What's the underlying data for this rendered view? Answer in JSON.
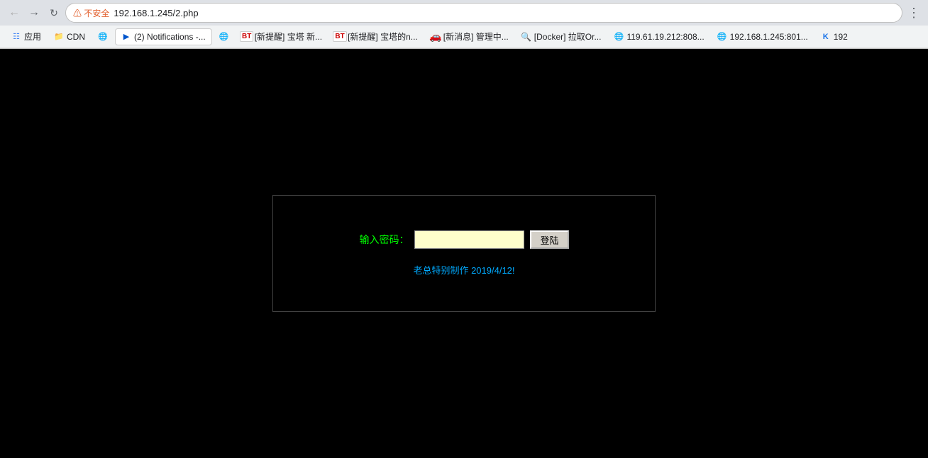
{
  "browser": {
    "back_title": "后退",
    "forward_title": "前进",
    "reload_title": "重新加载",
    "security_label": "不安全",
    "address": "192.168.1.245/2.php",
    "bookmarks": [
      {
        "id": "apps",
        "icon_type": "apps",
        "label": "应用"
      },
      {
        "id": "cdn",
        "icon_type": "folder",
        "label": "CDN"
      },
      {
        "id": "globe1",
        "icon_type": "globe",
        "label": ""
      },
      {
        "id": "notifications",
        "icon_type": "active",
        "label": "(2) Notifications -..."
      },
      {
        "id": "globe2",
        "icon_type": "globe2",
        "label": ""
      },
      {
        "id": "bt1",
        "icon_type": "bt",
        "label": "[新提醒] 宝塔 新..."
      },
      {
        "id": "bt2",
        "icon_type": "bt",
        "label": "[新提醒] 宝塔的n..."
      },
      {
        "id": "car",
        "icon_type": "red",
        "label": "[新消息] 管理中..."
      },
      {
        "id": "docker",
        "icon_type": "search",
        "label": "[Docker] 拉取Or..."
      },
      {
        "id": "globe3",
        "icon_type": "globe3",
        "label": "119.61.19.212:808..."
      },
      {
        "id": "globe4",
        "icon_type": "globe4",
        "label": "192.168.1.245:801..."
      },
      {
        "id": "k",
        "icon_type": "k",
        "label": "192"
      }
    ]
  },
  "page": {
    "password_label": "输入密码：",
    "password_placeholder": "",
    "login_button": "登陆",
    "footer_text": "老总特别制作 2019/4/12!"
  }
}
